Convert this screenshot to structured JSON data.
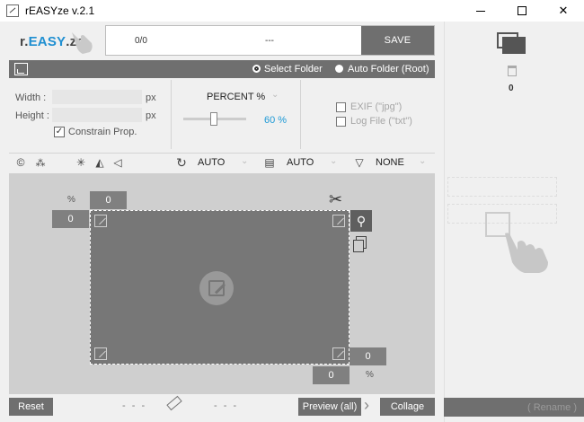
{
  "window": {
    "title": "rEASYze v.2.1",
    "controls": [
      "minimize",
      "maximize",
      "close"
    ]
  },
  "header": {
    "logo_prefix": "r.",
    "logo_mid": "EASY",
    "logo_suffix": ".ze",
    "count": "0/0",
    "status": "---",
    "save_label": "SAVE"
  },
  "folder_bar": {
    "select_folder": "Select Folder",
    "auto_folder": "Auto Folder (Root)",
    "selected": "Select Folder"
  },
  "size": {
    "width_label": "Width :",
    "height_label": "Height :",
    "width_value": "",
    "height_value": "",
    "unit": "px",
    "constrain_label": "Constrain Prop.",
    "constrain_checked": true
  },
  "scale": {
    "mode": "PERCENT %",
    "value": 60,
    "value_label": "60 %"
  },
  "options": {
    "exif_label": "EXIF (\"jpg\")",
    "log_label": "Log File (\"txt\")"
  },
  "toolbar": {
    "rotate_value": "AUTO",
    "format_value": "AUTO",
    "filter_value": "NONE"
  },
  "crop": {
    "top": "0",
    "left": "0",
    "right": "0",
    "bottom": "0",
    "pct": "%"
  },
  "footer": {
    "reset_label": "Reset",
    "dashes_left": "- - -",
    "dashes_right": "- - -",
    "preview_label": "Preview (all)",
    "collage_label": "Collage"
  },
  "right_panel": {
    "files_count": "0",
    "rename_label": "( Rename )"
  },
  "colors": {
    "accent": "#1f8fd1",
    "bar": "#6f6f6f",
    "canvas": "#cfcfcf"
  }
}
